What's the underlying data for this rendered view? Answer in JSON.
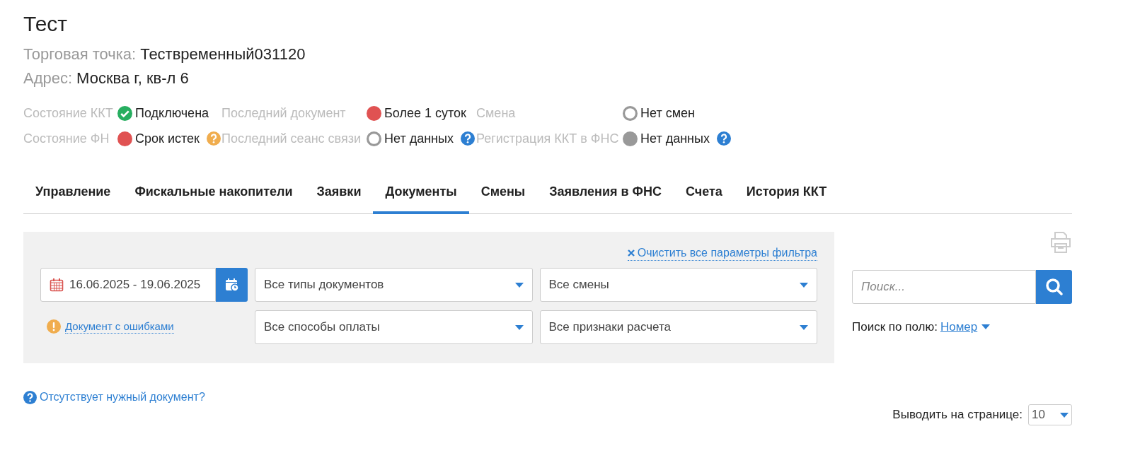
{
  "title": "Тест",
  "info": [
    {
      "label": "Торговая точка:",
      "value": "Тествременный031120"
    },
    {
      "label": "Адрес:",
      "value": "Москва г, кв-л 6"
    }
  ],
  "status": [
    {
      "label": "Состояние ККТ",
      "value": "Подключена",
      "kind": "check",
      "color": "#27ae60"
    },
    {
      "label": "Последний документ",
      "value": "Более 1 суток",
      "kind": "dot",
      "color": "#e05252"
    },
    {
      "label": "Смена",
      "value": "Нет смен",
      "kind": "ring",
      "color": "#999999"
    },
    {
      "label": "Состояние ФН",
      "value": "Срок истек",
      "kind": "dot",
      "color": "#e05252",
      "help": {
        "color": "#f0ad4e"
      }
    },
    {
      "label": "Последний сеанс связи",
      "value": "Нет данных",
      "kind": "ring",
      "color": "#999999",
      "help": {
        "color": "#2d7fd2"
      }
    },
    {
      "label": "Регистрация ККТ в ФНС",
      "value": "Нет данных",
      "kind": "dot",
      "color": "#999999",
      "help": {
        "color": "#2d7fd2"
      }
    }
  ],
  "tabs": [
    {
      "label": "Управление",
      "selected": false
    },
    {
      "label": "Фискальные накопители",
      "selected": false
    },
    {
      "label": "Заявки",
      "selected": false
    },
    {
      "label": "Документы",
      "selected": true
    },
    {
      "label": "Смены",
      "selected": false
    },
    {
      "label": "Заявления в ФНС",
      "selected": false
    },
    {
      "label": "Счета",
      "selected": false
    },
    {
      "label": "История ККТ",
      "selected": false
    }
  ],
  "filter": {
    "clear_link": "Очистить все параметры фильтра",
    "date_range": "16.06.2025 - 19.06.2025",
    "error_link": "Документ с ошибками",
    "selects": [
      "Все типы документов",
      "Все смены",
      "Все способы оплаты",
      "Все признаки расчета"
    ]
  },
  "search": {
    "placeholder": "Поиск...",
    "field_label": "Поиск по полю:",
    "field_value": "Номер"
  },
  "missing_link": "Отсутствует нужный документ?",
  "page_size": {
    "label": "Выводить на странице:",
    "value": "10"
  }
}
